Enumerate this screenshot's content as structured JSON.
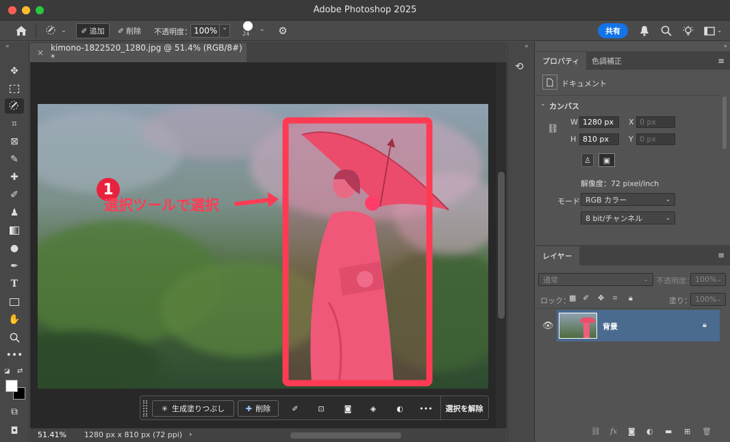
{
  "window": {
    "title": "Adobe Photoshop 2025"
  },
  "options": {
    "add_label": "追加",
    "delete_label": "削除",
    "opacity_label": "不透明度：",
    "opacity_value": "100%",
    "brush_size": "24",
    "share_label": "共有"
  },
  "document": {
    "tab_title": "kimono-1822520_1280.jpg @ 51.4% (RGB/8#) *",
    "close_glyph": "×"
  },
  "annotation": {
    "number": "1",
    "text": "選択ツールで選択"
  },
  "contextbar": {
    "generative_fill": "生成塗りつぶし",
    "delete": "削除",
    "deselect": "選択を解除",
    "more": "•••"
  },
  "status": {
    "zoom": "51.41%",
    "info": "1280 px x 810 px (72 ppi)",
    "arrow": "›"
  },
  "properties": {
    "tab_properties": "プロパティ",
    "tab_adjust": "色調補正",
    "doc_label": "ドキュメント",
    "canvas_label": "カンバス",
    "w_label": "W",
    "w_value": "1280 px",
    "h_label": "H",
    "h_value": "810 px",
    "x_label": "X",
    "x_value": "0 px",
    "y_label": "Y",
    "y_value": "0 px",
    "resolution": "解像度：72 pixel/inch",
    "mode_label": "モード",
    "mode_value": "RGB カラー",
    "depth_value": "8 bit/チャンネル"
  },
  "layers": {
    "tab_label": "レイヤー",
    "blend_mode": "通常",
    "opacity_label": "不透明度：",
    "opacity_value": "100%",
    "lock_label": "ロック：",
    "fill_label": "塗り：",
    "fill_value": "100%",
    "items": [
      {
        "name": "背景",
        "visible": true,
        "locked": true
      }
    ]
  },
  "icons": {
    "home": "home-icon",
    "gear": "gear-icon",
    "bell": "bell-icon",
    "search": "search-icon",
    "bulb": "bulb-icon"
  },
  "colors": {
    "accent": "#1473e6",
    "selection": "#ff3b54",
    "layer_selected": "#4a6a90"
  }
}
